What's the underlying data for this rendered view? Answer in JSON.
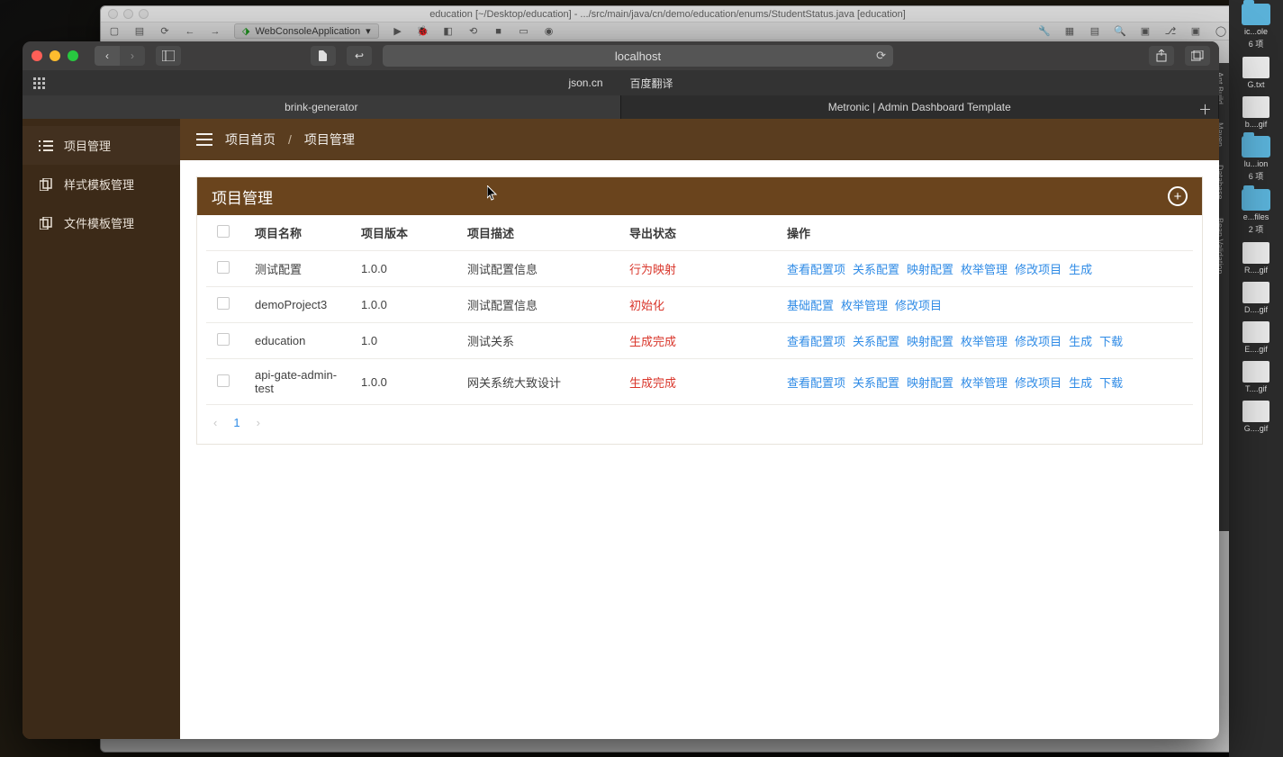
{
  "ide": {
    "title": "education [~/Desktop/education] - .../src/main/java/cn/demo/education/enums/StudentStatus.java [education]",
    "run_config": "WebConsoleApplication"
  },
  "browser": {
    "address": "localhost",
    "fav1": "json.cn",
    "fav2": "百度翻译",
    "tab1": "brink-generator",
    "tab2": "Metronic | Admin Dashboard Template"
  },
  "sidebar": {
    "items": [
      {
        "label": "项目管理"
      },
      {
        "label": "样式模板管理"
      },
      {
        "label": "文件模板管理"
      }
    ]
  },
  "header": {
    "home": "项目首页",
    "crumb": "项目管理"
  },
  "panel": {
    "title": "项目管理"
  },
  "table": {
    "head": {
      "c1": "项目名称",
      "c2": "项目版本",
      "c3": "项目描述",
      "c4": "导出状态",
      "c5": "操作"
    },
    "rows": [
      {
        "name": "测试配置",
        "version": "1.0.0",
        "desc": "测试配置信息",
        "status": "行为映射",
        "actions": [
          "查看配置项",
          "关系配置",
          "映射配置",
          "枚举管理",
          "修改项目",
          "生成"
        ]
      },
      {
        "name": "demoProject3",
        "version": "1.0.0",
        "desc": "测试配置信息",
        "status": "初始化",
        "actions": [
          "基础配置",
          "枚举管理",
          "修改项目"
        ]
      },
      {
        "name": "education",
        "version": "1.0",
        "desc": "测试关系",
        "status": "生成完成",
        "actions": [
          "查看配置项",
          "关系配置",
          "映射配置",
          "枚举管理",
          "修改项目",
          "生成",
          "下载"
        ]
      },
      {
        "name": "api-gate-admin-test",
        "version": "1.0.0",
        "desc": "网关系统大致设计",
        "status": "生成完成",
        "actions": [
          "查看配置项",
          "关系配置",
          "映射配置",
          "枚举管理",
          "修改项目",
          "生成",
          "下载"
        ]
      }
    ]
  },
  "pager": {
    "page": "1"
  },
  "desktop": {
    "rail": [
      "Ant Build",
      "Maven",
      "Database",
      "Bean Validation"
    ],
    "items": [
      {
        "label": "ic...ole",
        "sub": "6 项"
      },
      {
        "label": "G.txt"
      },
      {
        "label": "b....gif"
      },
      {
        "label": "lu...ion",
        "sub": "6 项"
      },
      {
        "label": "e...files",
        "sub": "2 项"
      },
      {
        "label": "R....gif"
      },
      {
        "label": "D....gif"
      },
      {
        "label": "E....gif"
      },
      {
        "label": "T....gif"
      },
      {
        "label": "G....gif"
      }
    ]
  }
}
